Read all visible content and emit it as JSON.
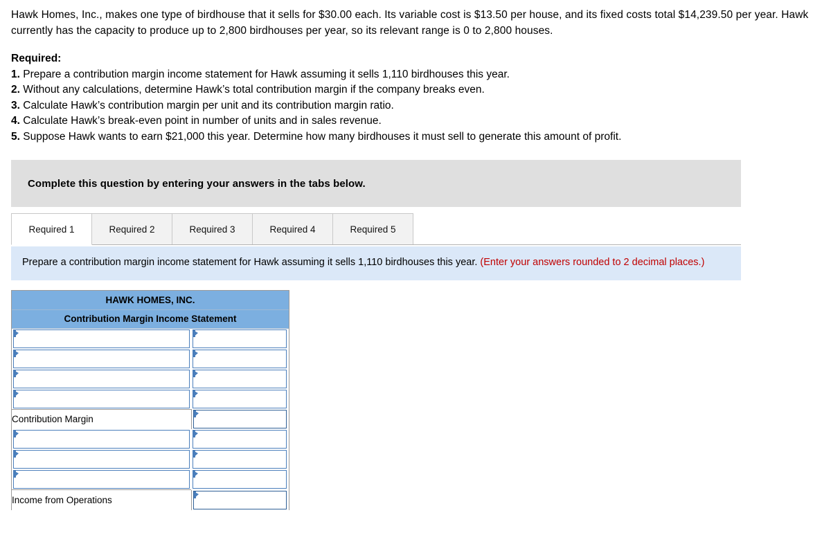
{
  "problem": {
    "paragraph": "Hawk Homes, Inc., makes one type of birdhouse that it sells for $30.00 each. Its variable cost is $13.50 per house, and its fixed costs total $14,239.50 per year. Hawk currently has the capacity to produce up to 2,800 birdhouses per year, so its relevant range is 0 to 2,800 houses."
  },
  "required": {
    "heading": "Required:",
    "items": [
      {
        "num": "1.",
        "text": "Prepare a contribution margin income statement for Hawk assuming it sells 1,110 birdhouses this year."
      },
      {
        "num": "2.",
        "text": "Without any calculations, determine Hawk’s total contribution margin if the company breaks even."
      },
      {
        "num": "3.",
        "text": "Calculate Hawk’s contribution margin per unit and its contribution margin ratio."
      },
      {
        "num": "4.",
        "text": "Calculate Hawk’s break-even point in number of units and in sales revenue."
      },
      {
        "num": "5.",
        "text": "Suppose Hawk wants to earn $21,000 this year. Determine how many birdhouses it must sell to generate this amount of profit."
      }
    ]
  },
  "banner": {
    "text": "Complete this question by entering your answers in the tabs below.",
    "background_color": "#dfdfdf"
  },
  "tabs": {
    "active_index": 0,
    "items": [
      {
        "label": "Required 1"
      },
      {
        "label": "Required 2"
      },
      {
        "label": "Required 3"
      },
      {
        "label": "Required 4"
      },
      {
        "label": "Required 5"
      }
    ]
  },
  "instruction": {
    "main": "Prepare a contribution margin income statement for Hawk assuming it sells 1,110 birdhouses this year.",
    "note": "(Enter your answers rounded to 2 decimal places.)",
    "note_color": "#c00000",
    "background_color": "#dbe8f8"
  },
  "statement": {
    "header_color": "#7cafe0",
    "title_line1": "HAWK HOMES, INC.",
    "title_line2": "Contribution Margin Income Statement",
    "rows": [
      {
        "label_type": "input",
        "label_value": "",
        "value_type": "input",
        "value": ""
      },
      {
        "label_type": "input",
        "label_value": "",
        "value_type": "input",
        "value": ""
      },
      {
        "label_type": "input",
        "label_value": "",
        "value_type": "input",
        "value": ""
      },
      {
        "label_type": "input",
        "label_value": "",
        "value_type": "input",
        "value": ""
      },
      {
        "label_type": "static",
        "label_value": "Contribution Margin",
        "value_type": "input",
        "value": ""
      },
      {
        "label_type": "input",
        "label_value": "",
        "value_type": "input",
        "value": ""
      },
      {
        "label_type": "input",
        "label_value": "",
        "value_type": "input",
        "value": ""
      },
      {
        "label_type": "input",
        "label_value": "",
        "value_type": "input",
        "value": ""
      },
      {
        "label_type": "static",
        "label_value": "Income from Operations",
        "value_type": "input",
        "value": ""
      }
    ]
  }
}
